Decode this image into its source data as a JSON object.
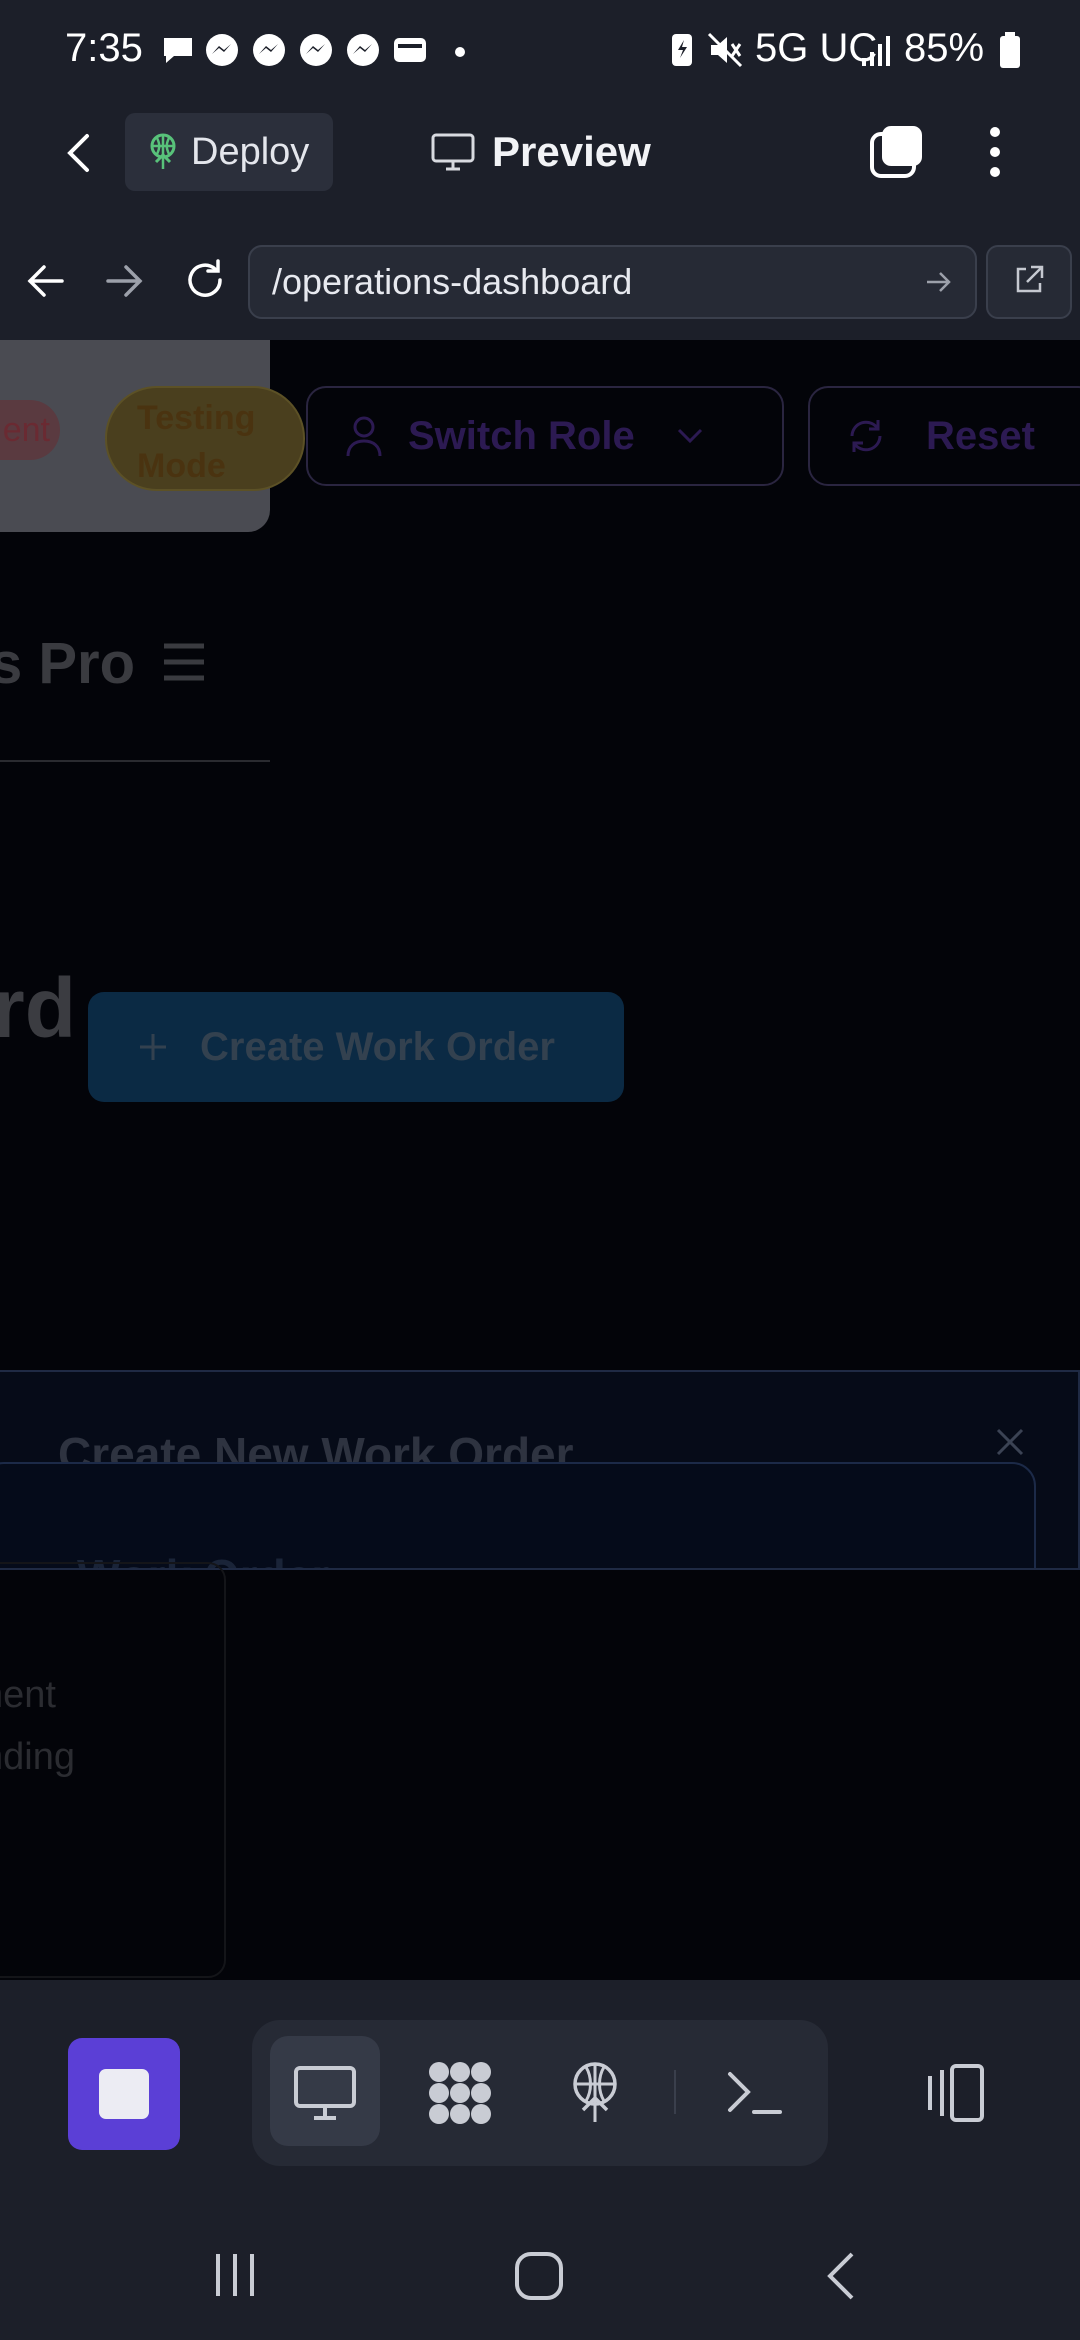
{
  "status_bar": {
    "time": "7:35",
    "network": "5G UC",
    "battery": "85%",
    "icons": [
      "chat-bubble-icon",
      "messenger-icon",
      "messenger-icon",
      "messenger-icon",
      "messenger-icon",
      "wallet-icon",
      "dot-icon",
      "battery-saver-icon",
      "mute-icon",
      "signal-icon",
      "battery-icon"
    ]
  },
  "header": {
    "deploy_label": "Deploy",
    "preview_label": "Preview"
  },
  "url_bar": {
    "path": "/operations-dashboard"
  },
  "page": {
    "pill_left": "ent",
    "testing_mode": "Testing Mode",
    "testing_line1": "Testing",
    "testing_line2": "Mode",
    "switch_role": "Switch Role",
    "reset": "Reset",
    "brand_fragment": "s Pro",
    "heading_fragment": "rd",
    "create_button": "Create Work Order",
    "modal_title": "Create New Work Order",
    "modal_subtitle": "Work Order",
    "card_line1": "nent",
    "card_line2": "nding"
  },
  "colors": {
    "accent": "#5b3fd6",
    "chrome_bg": "#1c1f29",
    "deploy_green": "#58c27a"
  }
}
